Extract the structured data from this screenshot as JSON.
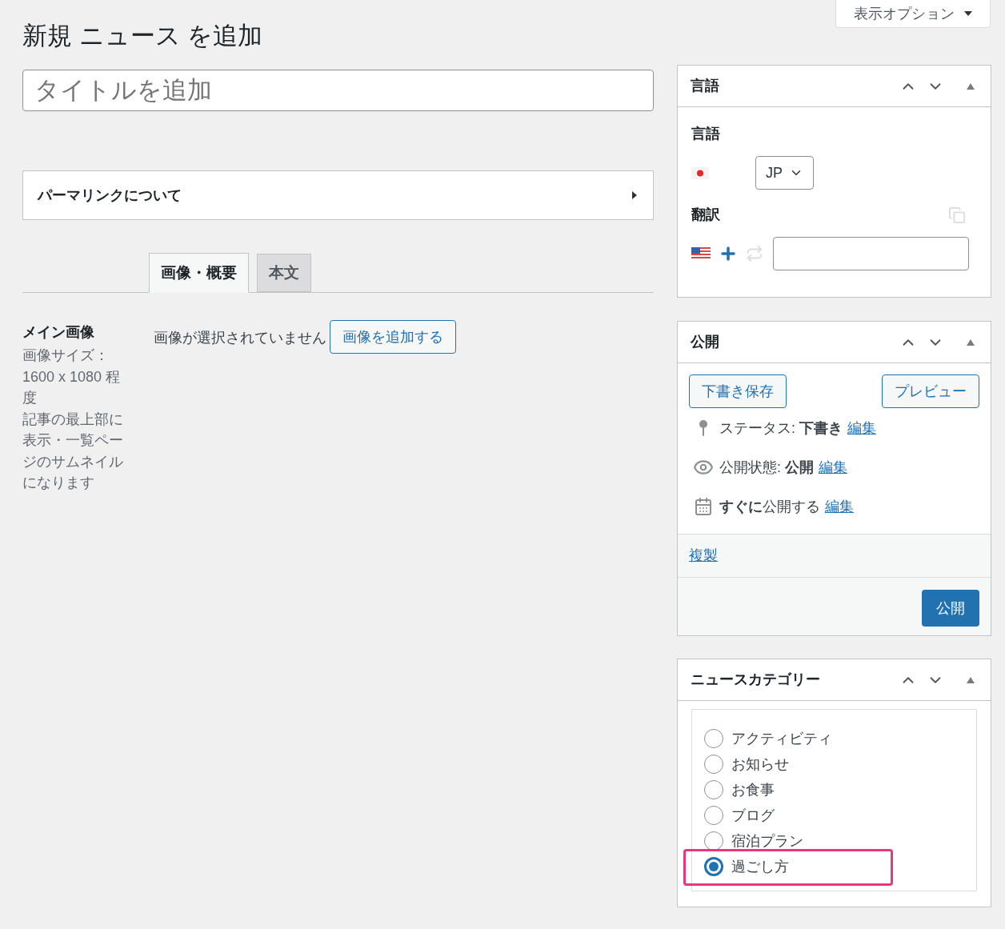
{
  "screen_options": {
    "label": "表示オプション"
  },
  "page_title": "新規 ニュース を追加",
  "title_field": {
    "placeholder": "タイトルを追加"
  },
  "permalink_box": {
    "title": "パーマリンクについて",
    "expanded": false
  },
  "tabs": [
    {
      "label": "画像・概要",
      "selected": true
    },
    {
      "label": "本文",
      "selected": false
    }
  ],
  "main_image": {
    "label": "メイン画像",
    "description_lines": [
      "画像サイズ：",
      "1600 x 1080 程",
      "度",
      "記事の最上部に",
      "表示・一覧ペー",
      "ジのサムネイル",
      "になります"
    ],
    "status": "画像が選択されていません",
    "button": "画像を追加する"
  },
  "language_box": {
    "title": "言語",
    "language_label": "言語",
    "language_select": "JP",
    "translation_label": "翻訳"
  },
  "publish_box": {
    "title": "公開",
    "save_draft": "下書き保存",
    "preview": "プレビュー",
    "rows": [
      {
        "kind": "status",
        "text": "ステータス: **下書き**",
        "link": "編集"
      },
      {
        "kind": "visibility",
        "text": "公開状態: **公開**",
        "link": "編集"
      },
      {
        "kind": "schedule",
        "text": "**すぐに**公開する",
        "link": "編集"
      }
    ],
    "duplicate_link": "複製",
    "publish_button": "公開"
  },
  "category_box": {
    "title": "ニュースカテゴリー",
    "items": [
      {
        "label": "アクティビティ",
        "selected": false,
        "highlighted": false
      },
      {
        "label": "お知らせ",
        "selected": false,
        "highlighted": false
      },
      {
        "label": "お食事",
        "selected": false,
        "highlighted": false
      },
      {
        "label": "ブログ",
        "selected": false,
        "highlighted": false
      },
      {
        "label": "宿泊プラン",
        "selected": false,
        "highlighted": false
      },
      {
        "label": "過ごし方",
        "selected": true,
        "highlighted": true
      }
    ]
  }
}
